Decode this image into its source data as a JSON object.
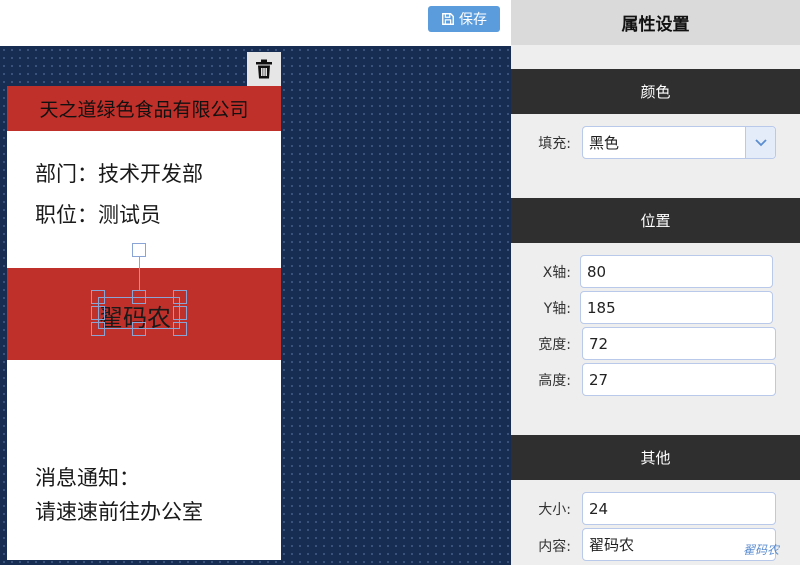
{
  "toolbar": {
    "save_label": "保存",
    "save_icon": "floppy-disk-icon"
  },
  "canvas": {
    "delete_icon": "trash-icon",
    "card": {
      "company": "天之道绿色食品有限公司",
      "department": "部门：技术开发部",
      "position": "职位：测试员",
      "name": "翟码农",
      "notice_title": "消息通知：",
      "notice_body": "请速速前往办公室"
    }
  },
  "panel": {
    "title": "属性设置",
    "color_section": {
      "header": "颜色",
      "fill_label": "填充:",
      "fill_value": "黑色"
    },
    "position_section": {
      "header": "位置",
      "x_label": "X轴:",
      "x_value": "80",
      "y_label": "Y轴:",
      "y_value": "185",
      "width_label": "宽度:",
      "width_value": "72",
      "height_label": "高度:",
      "height_value": "27"
    },
    "other_section": {
      "header": "其他",
      "size_label": "大小:",
      "size_value": "24",
      "content_label": "内容:",
      "content_value": "翟码农"
    }
  },
  "watermark": "翟码农",
  "colors": {
    "accent": "#5b9cdc",
    "card_red": "#c0302a",
    "canvas_bg": "#172d52",
    "section_head": "#2f2f2f"
  }
}
